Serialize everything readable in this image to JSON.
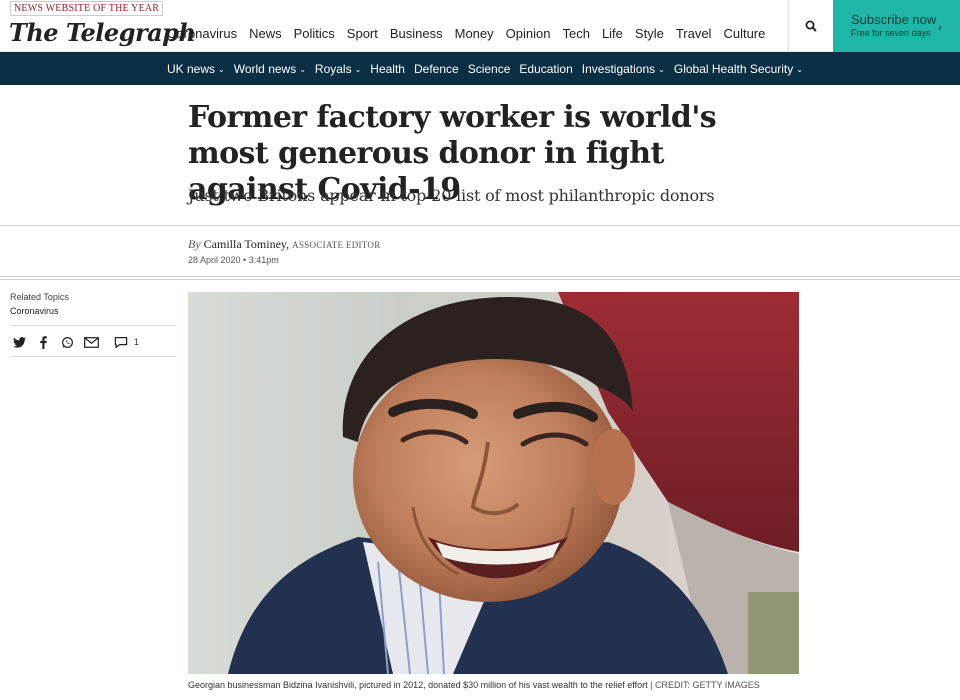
{
  "header": {
    "award": "NEWS WEBSITE OF THE YEAR",
    "logo": "The Telegraph",
    "nav": [
      {
        "label": "Coronavirus"
      },
      {
        "label": "News",
        "active": true
      },
      {
        "label": "Politics"
      },
      {
        "label": "Sport"
      },
      {
        "label": "Business"
      },
      {
        "label": "Money"
      },
      {
        "label": "Opinion"
      },
      {
        "label": "Tech"
      },
      {
        "label": "Life"
      },
      {
        "label": "Style"
      },
      {
        "label": "Travel"
      },
      {
        "label": "Culture"
      }
    ],
    "subscribe_title": "Subscribe now",
    "subscribe_sub": "Free for seven days",
    "accent_color": "#1fb5a7"
  },
  "subnav": {
    "items": [
      {
        "label": "UK news",
        "dropdown": true
      },
      {
        "label": "World news",
        "dropdown": true
      },
      {
        "label": "Royals",
        "dropdown": true
      },
      {
        "label": "Health",
        "dropdown": false
      },
      {
        "label": "Defence",
        "dropdown": false
      },
      {
        "label": "Science",
        "dropdown": false
      },
      {
        "label": "Education",
        "dropdown": false
      },
      {
        "label": "Investigations",
        "dropdown": true
      },
      {
        "label": "Global Health Security",
        "dropdown": true
      }
    ],
    "bg_color": "#0a2f45"
  },
  "article": {
    "headline": "Former factory worker is world's most generous donor in fight against Covid-19",
    "standfirst": "Just two Britons appear in top-20 list of most philanthropic donors",
    "by": "By",
    "author": "Camilla Tominey,",
    "role": "ASSOCIATE EDITOR",
    "date": "28 April 2020 • 3:41pm",
    "caption": "Georgian businessman Bidzina Ivanishvili, pictured in 2012, donated $30 million of his vast wealth to the relief effort",
    "credit": "| CREDIT: GETTY IMAGES"
  },
  "sidebar": {
    "related_label": "Related Topics",
    "related_topic": "Coronavirus",
    "comment_count": "1",
    "share_icons": [
      "twitter-icon",
      "facebook-icon",
      "whatsapp-icon",
      "email-icon",
      "comment-icon"
    ]
  }
}
